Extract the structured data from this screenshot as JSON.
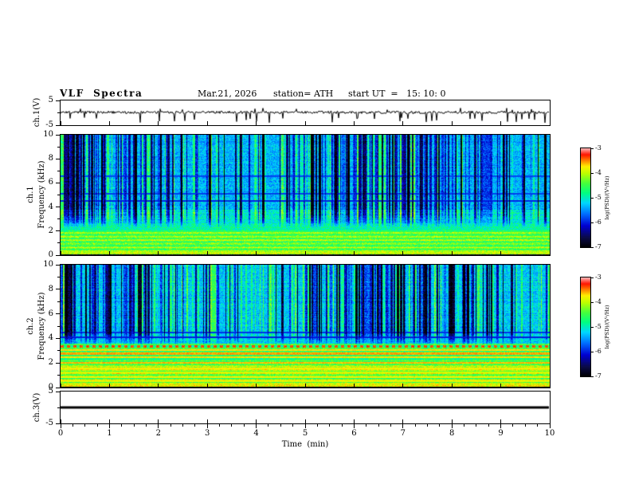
{
  "header": {
    "title": "VLF  Spectra",
    "date": "Mar.21, 2026",
    "station": "station= ATH",
    "start_ut": "start UT  =   15: 10: 0"
  },
  "xaxis": {
    "label": "Time  (min)",
    "ticks": [
      0,
      1,
      2,
      3,
      4,
      5,
      6,
      7,
      8,
      9,
      10
    ],
    "minor_step": 0.25,
    "lim": [
      0,
      10
    ]
  },
  "colorbar": {
    "label": "log(PSD)/(V²/Hz)",
    "ticks": [
      -3,
      -4,
      -5,
      -6,
      -7
    ],
    "min": -7,
    "max": -3
  },
  "colormap": {
    "stops": [
      [
        0.0,
        0,
        0,
        0
      ],
      [
        0.1,
        10,
        10,
        70
      ],
      [
        0.22,
        0,
        0,
        210
      ],
      [
        0.34,
        0,
        110,
        255
      ],
      [
        0.45,
        0,
        215,
        255
      ],
      [
        0.55,
        0,
        255,
        130
      ],
      [
        0.65,
        70,
        255,
        60
      ],
      [
        0.75,
        190,
        255,
        0
      ],
      [
        0.82,
        255,
        240,
        0
      ],
      [
        0.88,
        255,
        130,
        0
      ],
      [
        0.94,
        255,
        20,
        0
      ],
      [
        1.0,
        255,
        175,
        175
      ]
    ]
  },
  "chart_data": [
    {
      "type": "line",
      "name": "ch1_time_series",
      "ylabel": "ch.1(V)",
      "ylim": [
        -5,
        5
      ],
      "yticks": [
        5,
        -5
      ],
      "xlim": [
        0,
        10
      ],
      "description": "Broadband receiver voltage: noise around 0 V with frequent impulsive sferic spikes reaching about -4 V",
      "baseline": 0.2,
      "noise_amplitude": 0.55,
      "spike_probability": 0.055,
      "spike_depth": [
        -2.0,
        -4.3
      ],
      "up_spike_probability": 0.02,
      "up_spike_height": [
        1.2,
        2.2
      ],
      "line_width": 1,
      "color": "#000000",
      "seed": 7
    },
    {
      "type": "heatmap",
      "name": "ch1_spectrogram",
      "channel": "ch.1",
      "ylabel": "Frequency  (kHz)",
      "ylim": [
        0,
        10
      ],
      "yticks": [
        0,
        2,
        4,
        6,
        8,
        10
      ],
      "xlim": [
        0,
        10
      ],
      "value_range": [
        -7,
        -3
      ],
      "units": "log(PSD)/(V²/Hz)",
      "description": "VLF spectrogram ch.1: black band at DC, bright green-yellow striped band below ~2 kHz, cyan-blue background 3-10 kHz cut by dense dark-blue vertical sferic streaks and occasional bright green columns",
      "bands": [
        {
          "freq": [
            0,
            0.12
          ],
          "level": -7
        },
        {
          "freq": [
            0.12,
            0.35
          ],
          "level": -4.0
        },
        {
          "freq": [
            0.35,
            2.1
          ],
          "level": -4.35,
          "stripe_amp": 0.3,
          "stripe_wavelength": 0.3
        },
        {
          "freq": [
            2.1,
            2.7
          ],
          "level": -4.85
        },
        {
          "freq": [
            2.7,
            3.8
          ],
          "level": -5.05
        },
        {
          "freq": [
            3.8,
            10
          ],
          "level": -5.35
        }
      ],
      "bright_lines": [],
      "dark_lines": [
        {
          "freq": 4.55,
          "level": -5.95,
          "width": 0.07
        },
        {
          "freq": 5.15,
          "level": -5.85,
          "width": 0.07
        },
        {
          "freq": 6.6,
          "level": -5.8,
          "width": 0.07
        }
      ],
      "vertical_streaks": {
        "dark_fraction": 0.4,
        "dark_depth": 1.5,
        "bright_fraction": 0.14,
        "bright_boost": 0.8,
        "min_freq": 2.2,
        "ramp": 1.2
      },
      "noise": 0.32,
      "seed": 11
    },
    {
      "type": "heatmap",
      "name": "ch2_spectrogram",
      "channel": "ch.2",
      "ylabel": "Frequency  (kHz)",
      "ylim": [
        0,
        10
      ],
      "yticks": [
        0,
        2,
        4,
        6,
        8,
        10
      ],
      "xlim": [
        0,
        10
      ],
      "value_range": [
        -7,
        -3
      ],
      "units": "log(PSD)/(V²/Hz)",
      "description": "VLF spectrogram ch.2: like ch.1 but with many narrow yellow-orange-red horizontal interference lines between ~0.5 and 3.5 kHz, including a dotted red line near 3.4 kHz",
      "bands": [
        {
          "freq": [
            0,
            0.12
          ],
          "level": -7
        },
        {
          "freq": [
            0.12,
            0.4
          ],
          "level": -3.9
        },
        {
          "freq": [
            0.4,
            2.2
          ],
          "level": -4.25,
          "stripe_amp": 0.35,
          "stripe_wavelength": 0.28
        },
        {
          "freq": [
            2.2,
            3.6
          ],
          "level": -4.6,
          "stripe_amp": 0.2,
          "stripe_wavelength": 0.35
        },
        {
          "freq": [
            3.6,
            10
          ],
          "level": -5.25
        }
      ],
      "bright_lines": [
        {
          "freq": 0.55,
          "level": -3.8,
          "width": 0.07
        },
        {
          "freq": 0.85,
          "level": -3.8,
          "width": 0.07
        },
        {
          "freq": 1.25,
          "level": -3.9,
          "width": 0.07
        },
        {
          "freq": 1.6,
          "level": -3.75,
          "width": 0.07
        },
        {
          "freq": 2.05,
          "level": -3.6,
          "width": 0.08
        },
        {
          "freq": 2.5,
          "level": -3.7,
          "width": 0.07
        },
        {
          "freq": 2.8,
          "level": -3.55,
          "width": 0.08
        },
        {
          "freq": 3.1,
          "level": -3.7,
          "width": 0.07
        },
        {
          "freq": 3.4,
          "level": -3.35,
          "width": 0.1,
          "dotted": true
        }
      ],
      "dark_lines": [
        {
          "freq": 4.1,
          "level": -6.0,
          "width": 0.07
        },
        {
          "freq": 4.5,
          "level": -5.9,
          "width": 0.07
        }
      ],
      "vertical_streaks": {
        "dark_fraction": 0.38,
        "dark_depth": 1.5,
        "bright_fraction": 0.16,
        "bright_boost": 0.8,
        "min_freq": 3.4,
        "ramp": 1.2
      },
      "noise": 0.32,
      "seed": 23
    },
    {
      "type": "line",
      "name": "ch3_time_series",
      "ylabel": "ch.3(V)",
      "ylim": [
        -5,
        5
      ],
      "yticks": [
        5,
        -5
      ],
      "xlim": [
        0,
        10
      ],
      "description": "Constant 0 V flat thick line (channel inactive)",
      "baseline": 0,
      "noise_amplitude": 0,
      "spike_probability": 0,
      "up_spike_probability": 0,
      "line_width": 3,
      "color": "#000000",
      "seed": 3
    }
  ]
}
